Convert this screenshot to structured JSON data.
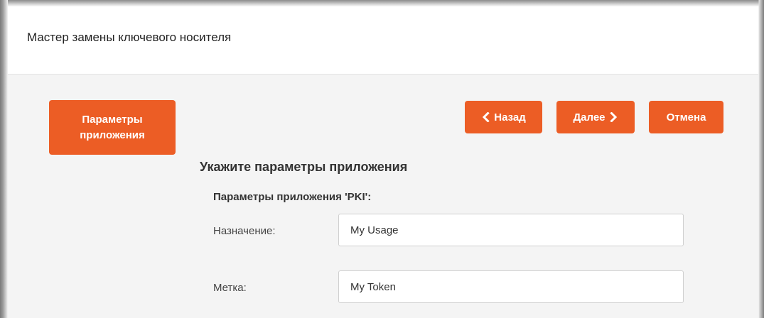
{
  "dialog": {
    "title": "Мастер замены ключевого носителя"
  },
  "steps": {
    "current_line1": "Параметры",
    "current_line2": "приложения"
  },
  "nav": {
    "back_label": "Назад",
    "next_label": "Далее",
    "cancel_label": "Отмена"
  },
  "form": {
    "heading": "Укажите параметры приложения",
    "subheading": "Параметры приложения 'PKI':",
    "usage_label": "Назначение:",
    "usage_value": "My Usage",
    "token_label": "Метка:",
    "token_value": "My Token"
  },
  "colors": {
    "accent": "#ec5d25",
    "body_bg": "#f4f4f4",
    "header_bg": "#ffffff"
  },
  "icons": {
    "back": "chevron-left-icon",
    "next": "chevron-right-icon"
  }
}
